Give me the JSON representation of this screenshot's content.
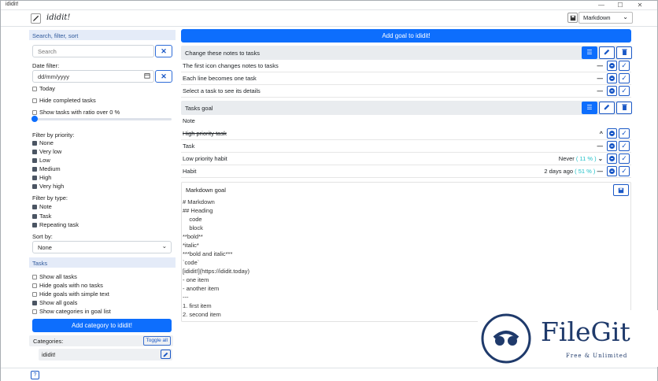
{
  "window": {
    "title": "ididit!",
    "min": "—",
    "max": "☐",
    "close": "✕"
  },
  "toolbar": {
    "app_title": "ididit!",
    "format": "Markdown",
    "format_caret": "⌄"
  },
  "sidebar": {
    "search_section": "Search, filter, sort",
    "search_placeholder": "Search",
    "clear": "✕",
    "date_filter_label": "Date filter:",
    "date_placeholder": "dd/mm/yyyy",
    "today": "Today",
    "hide_completed": "Hide completed tasks",
    "ratio": "Show tasks with ratio over 0 %",
    "priority_label": "Filter by priority:",
    "priorities": [
      {
        "label": "None",
        "on": true
      },
      {
        "label": "Very low",
        "on": true
      },
      {
        "label": "Low",
        "on": true
      },
      {
        "label": "Medium",
        "on": true
      },
      {
        "label": "High",
        "on": true
      },
      {
        "label": "Very high",
        "on": true
      }
    ],
    "type_label": "Filter by type:",
    "types": [
      {
        "label": "Note",
        "on": true
      },
      {
        "label": "Task",
        "on": true
      },
      {
        "label": "Repeating task",
        "on": true
      }
    ],
    "sort_label": "Sort by:",
    "sort_value": "None",
    "sort_caret": "⌄",
    "tasks_section": "Tasks",
    "task_opts": [
      {
        "label": "Show all tasks",
        "on": false
      },
      {
        "label": "Hide goals with no tasks",
        "on": false
      },
      {
        "label": "Hide goals with simple text",
        "on": false
      },
      {
        "label": "Show all goals",
        "on": true
      },
      {
        "label": "Show categories in goal list",
        "on": false
      }
    ],
    "add_category": "Add category to ididit!",
    "categories_label": "Categories:",
    "toggle_all": "Toggle all",
    "category": "ididit!"
  },
  "main": {
    "add_goal": "Add goal to ididit!",
    "goal1": {
      "title": "Change these notes to tasks",
      "rows": [
        {
          "text": "The first icon changes notes to tasks",
          "mark": "—"
        },
        {
          "text": "Each line becomes one task",
          "mark": "—"
        },
        {
          "text": "Select a task to see its details",
          "mark": "—"
        }
      ]
    },
    "goal2": {
      "title": "Tasks goal",
      "note": "Note",
      "rows": [
        {
          "text": "High priority task",
          "mark": "^"
        },
        {
          "text": "Task",
          "mark": "—"
        },
        {
          "text": "Low priority habit",
          "info": "Never",
          "pct": "( 11 % )",
          "mark": "⌄"
        },
        {
          "text": "Habit",
          "info": "2 days ago",
          "pct": "( 51 % )",
          "mark": "—"
        }
      ]
    },
    "md_title": "Markdown goal",
    "md_lines": [
      "# Markdown",
      "## Heading",
      "    code",
      "    block",
      "**bold**",
      "*italic*",
      "***bold and italic***",
      "`code`",
      "[ididit!](https://ididit.today)",
      "- one item",
      "- another item",
      "---",
      "1. first item",
      "2. second item"
    ]
  },
  "watermark": {
    "brand": "FileGit",
    "tagline": "Free & Unlimited"
  },
  "colors": {
    "accent": "#0d6efd",
    "section_bg": "#e4ebf8",
    "pct": "#20c0c8"
  }
}
